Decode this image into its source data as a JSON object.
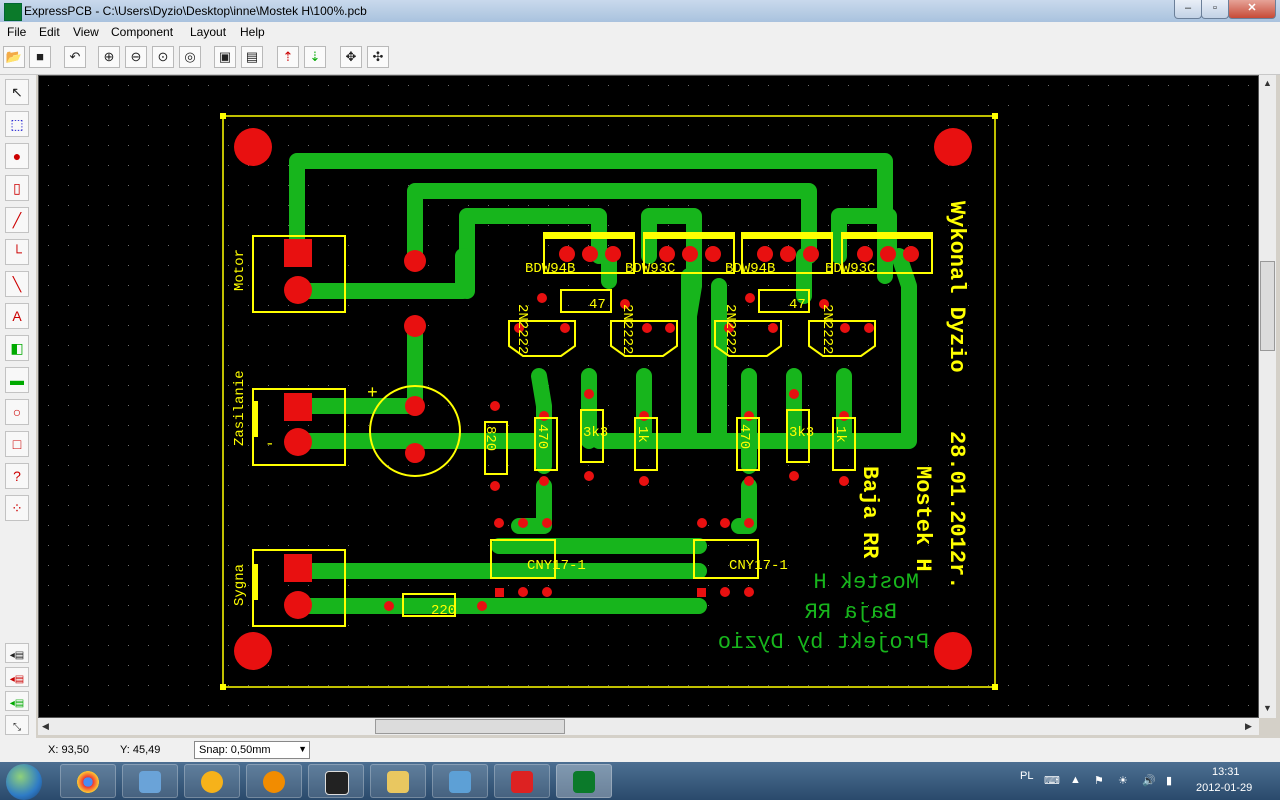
{
  "window": {
    "title": "ExpressPCB - C:\\Users\\Dyzio\\Desktop\\inne\\Mostek H\\100%.pcb"
  },
  "menu": [
    "File",
    "Edit",
    "View",
    "Component",
    "Layout",
    "Help"
  ],
  "toolbar": [
    "open-icon",
    "save-icon",
    "undo-icon",
    "zoom-in-icon",
    "zoom-out-icon",
    "zoom-fit-icon",
    "zoom-board-icon",
    "properties-icon",
    "layer-icon",
    "top-layer-icon",
    "bottom-layer-icon",
    "move-icon",
    "pan-icon"
  ],
  "tools": [
    "pointer-icon",
    "select-area-icon",
    "pad-icon",
    "component-icon",
    "trace-icon",
    "corner-icon",
    "wire-icon",
    "text-icon",
    "layer-swap-icon",
    "ground-plane-icon",
    "hole-icon",
    "board-outline-icon",
    "net-query-icon",
    "netlist-icon"
  ],
  "pcb": {
    "components": {
      "q1": "BDW94B",
      "q2": "BDW93C",
      "q3": "BDW94B",
      "q4": "BDW93C",
      "t1": "2N2222",
      "t2": "2N2222",
      "t3": "2N2222",
      "t4": "2N2222",
      "r47a": "47",
      "r47b": "47",
      "r820": "820",
      "r470a": "470",
      "r3k3a": "3k3",
      "r1ka": "1k",
      "r470b": "470",
      "r3k3b": "3k3",
      "r1kb": "1k",
      "cny1": "CNY17-1",
      "cny2": "CNY17-1",
      "r220": "220"
    },
    "labels": {
      "motor": "Motor",
      "zasilanie": "Zasilanie",
      "sygnal": "Sygna",
      "plus": "+",
      "minus": "-",
      "silk_author": "Wykonal Dyzio",
      "silk_date": "28.01.2012r.",
      "silk_title": "Mostek H",
      "silk_rr": "Baja RR",
      "copper_title": "Mostek H",
      "copper_rr": "Baja RR",
      "copper_author": "Projekt by Dyzio"
    }
  },
  "status": {
    "x": "X: 93,50",
    "y": "Y: 45,49",
    "snap": "Snap: 0,50mm"
  },
  "taskbar": {
    "apps": [
      "chrome-icon",
      "explorer-icon",
      "weather-icon",
      "vlc-icon",
      "nfs-icon",
      "folder-icon",
      "photos-icon",
      "pdf-icon",
      "expresspcb-icon"
    ],
    "lang": "PL",
    "time": "13:31",
    "date": "2012-01-29"
  },
  "colors": {
    "copper": "#17b51c",
    "silk": "#ffff00",
    "pad": "#e81010",
    "background": "#000000"
  }
}
